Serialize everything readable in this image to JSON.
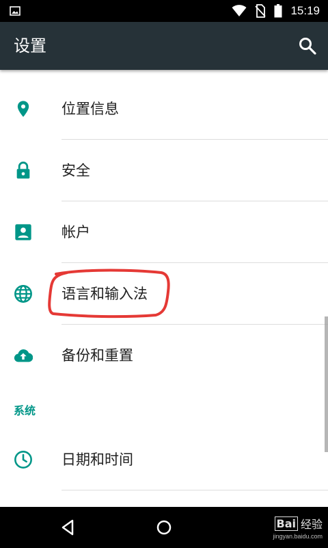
{
  "status_bar": {
    "time": "15:19",
    "icons": [
      "image-icon",
      "wifi-icon",
      "no-sim-icon",
      "battery-icon"
    ]
  },
  "app_bar": {
    "title": "设置",
    "search_icon": "search-icon",
    "background": "#263238"
  },
  "settings": {
    "items": [
      {
        "label": "位置信息",
        "icon": "location-icon"
      },
      {
        "label": "安全",
        "icon": "lock-icon"
      },
      {
        "label": "帐户",
        "icon": "account-icon"
      },
      {
        "label": "语言和输入法",
        "icon": "globe-icon"
      },
      {
        "label": "备份和重置",
        "icon": "cloud-upload-icon"
      }
    ],
    "accent": "#009688"
  },
  "system_section": {
    "header": "系统",
    "items": [
      {
        "label": "日期和时间",
        "icon": "clock-icon"
      }
    ]
  },
  "annotation": {
    "color": "#e53935",
    "target": "语言和输入法"
  },
  "nav_bar": {
    "buttons": [
      "back-icon",
      "home-icon"
    ]
  },
  "watermark": {
    "logo": "Bai",
    "main": "经验",
    "sub": "jingyan.baidu.com"
  }
}
